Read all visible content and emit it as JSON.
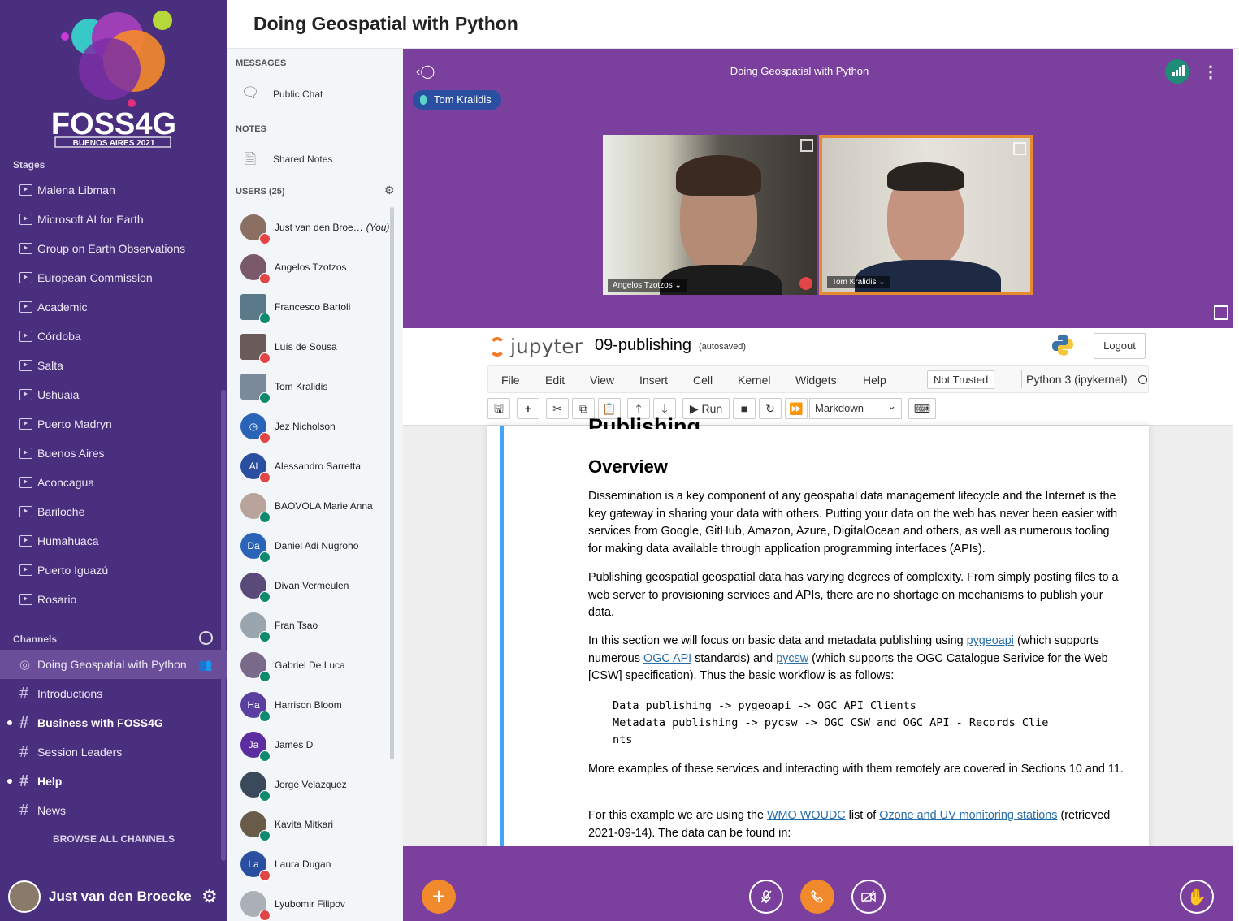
{
  "nav": {
    "logo_text": "FOSS4G",
    "logo_sub": "BUENOS AIRES 2021",
    "stages_label": "Stages",
    "stages": [
      "Malena Libman",
      "Microsoft AI for Earth",
      "Group on Earth Observations",
      "European Commission",
      "Academic",
      "Córdoba",
      "Salta",
      "Ushuaia",
      "Puerto Madryn",
      "Buenos Aires",
      "Aconcagua",
      "Bariloche",
      "Humahuaca",
      "Puerto Iguazú",
      "Rosario"
    ],
    "channels_label": "Channels",
    "channels": [
      {
        "name": "Doing Geospatial with Python",
        "type": "stage",
        "active": true,
        "unread": false
      },
      {
        "name": "Introductions",
        "type": "hash",
        "active": false,
        "unread": false
      },
      {
        "name": "Business with FOSS4G",
        "type": "hash",
        "active": false,
        "unread": true
      },
      {
        "name": "Session Leaders",
        "type": "hash",
        "active": false,
        "unread": false
      },
      {
        "name": "Help",
        "type": "hash",
        "active": false,
        "unread": true
      },
      {
        "name": "News",
        "type": "hash",
        "active": false,
        "unread": false
      }
    ],
    "browse_all": "BROWSE ALL CHANNELS",
    "current_user": "Just van den Broecke"
  },
  "header": {
    "title": "Doing Geospatial with Python"
  },
  "bbb_sidebar": {
    "messages_label": "MESSAGES",
    "public_chat": "Public Chat",
    "notes_label": "NOTES",
    "shared_notes": "Shared Notes",
    "users_label": "USERS (25)",
    "users": [
      {
        "name": "Just van den Broe…",
        "you": "(You)",
        "initials": "",
        "status": "muted",
        "color": "#8a6f62"
      },
      {
        "name": "Angelos Tzotzos",
        "initials": "",
        "status": "muted",
        "color": "#7a5a6a"
      },
      {
        "name": "Francesco Bartoli",
        "initials": "",
        "status": "listen",
        "color": "#5a7a8a",
        "square": true
      },
      {
        "name": "Luís de Sousa",
        "initials": "",
        "status": "muted",
        "color": "#6a5a5a",
        "square": true
      },
      {
        "name": "Tom Kralidis",
        "initials": "",
        "status": "listen",
        "color": "#7a8a9a",
        "square": true
      },
      {
        "name": "Jez Nicholson",
        "initials": "◷",
        "status": "muted",
        "color": "#2a64b8"
      },
      {
        "name": "Alessandro Sarretta",
        "initials": "Al",
        "status": "muted",
        "color": "#2a4fa0"
      },
      {
        "name": "BAOVOLA Marie Anna",
        "initials": "",
        "status": "listen",
        "color": "#b8a49a"
      },
      {
        "name": "Daniel Adi Nugroho",
        "initials": "Da",
        "status": "listen",
        "color": "#2a64b8"
      },
      {
        "name": "Divan Vermeulen",
        "initials": "",
        "status": "listen",
        "color": "#5a4a7a"
      },
      {
        "name": "Fran Tsao",
        "initials": "",
        "status": "listen",
        "color": "#9aa6ae"
      },
      {
        "name": "Gabriel De Luca",
        "initials": "",
        "status": "listen",
        "color": "#7a6a8a"
      },
      {
        "name": "Harrison Bloom",
        "initials": "Ha",
        "status": "listen",
        "color": "#5b3fa0"
      },
      {
        "name": "James D",
        "initials": "Ja",
        "status": "listen",
        "color": "#5b2d9e"
      },
      {
        "name": "Jorge Velazquez",
        "initials": "",
        "status": "listen",
        "color": "#3a4a5a"
      },
      {
        "name": "Kavita Mitkari",
        "initials": "",
        "status": "listen",
        "color": "#6a5a4a"
      },
      {
        "name": "Laura Dugan",
        "initials": "La",
        "status": "muted",
        "color": "#2a4fa0"
      },
      {
        "name": "Lyubomir Filipov",
        "initials": "",
        "status": "muted",
        "color": "#aab0b6"
      }
    ]
  },
  "conference": {
    "title": "Doing Geospatial with Python",
    "talking": "Tom Kralidis",
    "videos": [
      {
        "name": "Angelos Tzotzos ⌄",
        "muted": true
      },
      {
        "name": "Tom Kralidis ⌄",
        "muted": false
      }
    ]
  },
  "jupyter": {
    "logo": "jupyter",
    "notebook_name": "09-publishing",
    "autosave": "(autosaved)",
    "logout": "Logout",
    "menu": [
      "File",
      "Edit",
      "View",
      "Insert",
      "Cell",
      "Kernel",
      "Widgets",
      "Help"
    ],
    "not_trusted": "Not Trusted",
    "kernel": "Python 3 (ipykernel)",
    "run_label": "Run",
    "cell_type": "Markdown",
    "cell": {
      "h1": "Publishing",
      "h2": "Overview",
      "p1": "Dissemination is a key component of any geospatial data management lifecycle and the Internet is the key gateway in sharing your data with others. Putting your data on the web has never been easier with services from Google, GitHub, Amazon, Azure, DigitalOcean and others, as well as numerous tooling for making data available through application programming interfaces (APIs).",
      "p2": "Publishing geospatial geospatial data has varying degrees of complexity. From simply posting files to a web server to provisioning services and APIs, there are no shortage on mechanisms to publish your data.",
      "p3_a": "In this section we will focus on basic data and metadata publishing using ",
      "p3_link1": "pygeoapi",
      "p3_b": " (which supports numerous ",
      "p3_link2": "OGC API",
      "p3_c": " standards) and ",
      "p3_link3": "pycsw",
      "p3_d": " (which supports the OGC Catalogue Serivice for the Web [CSW] specification). Thus the basic workflow is as follows:",
      "code": "Data publishing -> pygeoapi -> OGC API Clients\nMetadata publishing -> pycsw -> OGC CSW and OGC API - Records Clie\nnts",
      "p4": "More examples of these services and interacting with them remotely are covered in Sections 10 and 11.",
      "p5_a": "For this example we are using the ",
      "p5_link1": "WMO WOUDC",
      "p5_b": " list of ",
      "p5_link2": "Ozone and UV monitoring stations",
      "p5_c": " (retrieved 2021-09-14). The data can be found in:"
    }
  },
  "icons": {
    "add": "plus-icon",
    "mic": "mic-muted-icon",
    "phone": "phone-icon",
    "camera": "camera-off-icon",
    "hand": "raise-hand-icon"
  },
  "colors": {
    "nav_bg": "#4a2f7e",
    "conf_bg": "#7b3f9e",
    "accent_orange": "#f08a2c",
    "muted_red": "#e14545",
    "listen_green": "#0f8a6e"
  }
}
